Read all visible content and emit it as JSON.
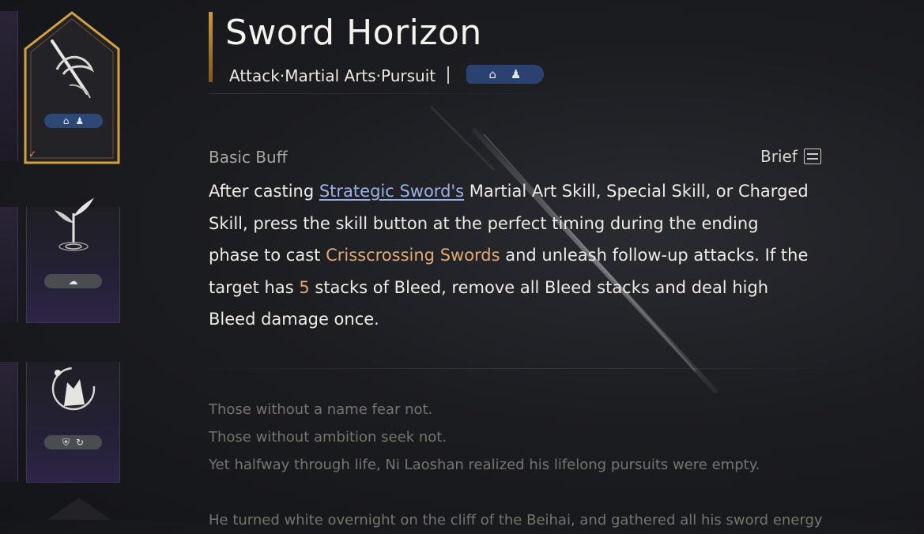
{
  "skill": {
    "title": "Sword Horizon",
    "tags": "Attack·Martial Arts·Pursuit"
  },
  "buff": {
    "section_label": "Basic Buff",
    "brief_label": "Brief",
    "desc_1": "After casting ",
    "link_strategic_sword": "Strategic Sword's",
    "desc_2": " Martial Art Skill, Special Skill, or Charged Skill, press the skill button at the perfect timing during the ending phase to cast ",
    "highlight_crisscrossing": "Crisscrossing Swords",
    "desc_3": " and unleash follow-up attacks. If the target has ",
    "highlight_stacks": "5",
    "desc_4": " stacks of Bleed, remove all Bleed stacks and deal high Bleed damage once."
  },
  "lore": {
    "lines": [
      "Those without a name fear not.",
      "Those without ambition seek not.",
      "Yet halfway through life, Ni Laoshan realized his lifelong pursuits were empty.",
      "He turned white overnight on the cliff of the Beihai, and gathered all his sword energy"
    ]
  },
  "icons": {
    "selected_card": "sword-brush-icon",
    "card_2": "plant-ripple-icon",
    "card_3": "wolf-moon-icon",
    "tag_1": "building-icon",
    "tag_2": "figure-icon",
    "brief": "list-toggle-icon"
  },
  "colors": {
    "accent_gold": "#c99a4a",
    "link_blue": "#9cb0e6",
    "highlight_orange": "#e5a872",
    "tag_blue": "#2b4270"
  }
}
